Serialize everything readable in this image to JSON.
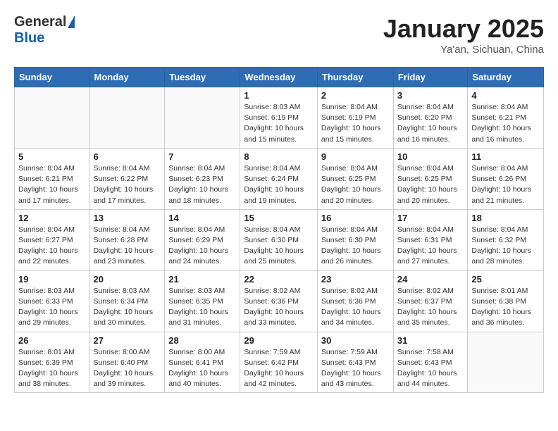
{
  "logo": {
    "general": "General",
    "blue": "Blue"
  },
  "title": "January 2025",
  "subtitle": "Ya'an, Sichuan, China",
  "weekdays": [
    "Sunday",
    "Monday",
    "Tuesday",
    "Wednesday",
    "Thursday",
    "Friday",
    "Saturday"
  ],
  "weeks": [
    [
      {
        "day": "",
        "info": ""
      },
      {
        "day": "",
        "info": ""
      },
      {
        "day": "",
        "info": ""
      },
      {
        "day": "1",
        "info": "Sunrise: 8:03 AM\nSunset: 6:19 PM\nDaylight: 10 hours\nand 15 minutes."
      },
      {
        "day": "2",
        "info": "Sunrise: 8:04 AM\nSunset: 6:19 PM\nDaylight: 10 hours\nand 15 minutes."
      },
      {
        "day": "3",
        "info": "Sunrise: 8:04 AM\nSunset: 6:20 PM\nDaylight: 10 hours\nand 16 minutes."
      },
      {
        "day": "4",
        "info": "Sunrise: 8:04 AM\nSunset: 6:21 PM\nDaylight: 10 hours\nand 16 minutes."
      }
    ],
    [
      {
        "day": "5",
        "info": "Sunrise: 8:04 AM\nSunset: 6:21 PM\nDaylight: 10 hours\nand 17 minutes."
      },
      {
        "day": "6",
        "info": "Sunrise: 8:04 AM\nSunset: 6:22 PM\nDaylight: 10 hours\nand 17 minutes."
      },
      {
        "day": "7",
        "info": "Sunrise: 8:04 AM\nSunset: 6:23 PM\nDaylight: 10 hours\nand 18 minutes."
      },
      {
        "day": "8",
        "info": "Sunrise: 8:04 AM\nSunset: 6:24 PM\nDaylight: 10 hours\nand 19 minutes."
      },
      {
        "day": "9",
        "info": "Sunrise: 8:04 AM\nSunset: 6:25 PM\nDaylight: 10 hours\nand 20 minutes."
      },
      {
        "day": "10",
        "info": "Sunrise: 8:04 AM\nSunset: 6:25 PM\nDaylight: 10 hours\nand 20 minutes."
      },
      {
        "day": "11",
        "info": "Sunrise: 8:04 AM\nSunset: 6:26 PM\nDaylight: 10 hours\nand 21 minutes."
      }
    ],
    [
      {
        "day": "12",
        "info": "Sunrise: 8:04 AM\nSunset: 6:27 PM\nDaylight: 10 hours\nand 22 minutes."
      },
      {
        "day": "13",
        "info": "Sunrise: 8:04 AM\nSunset: 6:28 PM\nDaylight: 10 hours\nand 23 minutes."
      },
      {
        "day": "14",
        "info": "Sunrise: 8:04 AM\nSunset: 6:29 PM\nDaylight: 10 hours\nand 24 minutes."
      },
      {
        "day": "15",
        "info": "Sunrise: 8:04 AM\nSunset: 6:30 PM\nDaylight: 10 hours\nand 25 minutes."
      },
      {
        "day": "16",
        "info": "Sunrise: 8:04 AM\nSunset: 6:30 PM\nDaylight: 10 hours\nand 26 minutes."
      },
      {
        "day": "17",
        "info": "Sunrise: 8:04 AM\nSunset: 6:31 PM\nDaylight: 10 hours\nand 27 minutes."
      },
      {
        "day": "18",
        "info": "Sunrise: 8:04 AM\nSunset: 6:32 PM\nDaylight: 10 hours\nand 28 minutes."
      }
    ],
    [
      {
        "day": "19",
        "info": "Sunrise: 8:03 AM\nSunset: 6:33 PM\nDaylight: 10 hours\nand 29 minutes."
      },
      {
        "day": "20",
        "info": "Sunrise: 8:03 AM\nSunset: 6:34 PM\nDaylight: 10 hours\nand 30 minutes."
      },
      {
        "day": "21",
        "info": "Sunrise: 8:03 AM\nSunset: 6:35 PM\nDaylight: 10 hours\nand 31 minutes."
      },
      {
        "day": "22",
        "info": "Sunrise: 8:02 AM\nSunset: 6:36 PM\nDaylight: 10 hours\nand 33 minutes."
      },
      {
        "day": "23",
        "info": "Sunrise: 8:02 AM\nSunset: 6:36 PM\nDaylight: 10 hours\nand 34 minutes."
      },
      {
        "day": "24",
        "info": "Sunrise: 8:02 AM\nSunset: 6:37 PM\nDaylight: 10 hours\nand 35 minutes."
      },
      {
        "day": "25",
        "info": "Sunrise: 8:01 AM\nSunset: 6:38 PM\nDaylight: 10 hours\nand 36 minutes."
      }
    ],
    [
      {
        "day": "26",
        "info": "Sunrise: 8:01 AM\nSunset: 6:39 PM\nDaylight: 10 hours\nand 38 minutes."
      },
      {
        "day": "27",
        "info": "Sunrise: 8:00 AM\nSunset: 6:40 PM\nDaylight: 10 hours\nand 39 minutes."
      },
      {
        "day": "28",
        "info": "Sunrise: 8:00 AM\nSunset: 6:41 PM\nDaylight: 10 hours\nand 40 minutes."
      },
      {
        "day": "29",
        "info": "Sunrise: 7:59 AM\nSunset: 6:42 PM\nDaylight: 10 hours\nand 42 minutes."
      },
      {
        "day": "30",
        "info": "Sunrise: 7:59 AM\nSunset: 6:43 PM\nDaylight: 10 hours\nand 43 minutes."
      },
      {
        "day": "31",
        "info": "Sunrise: 7:58 AM\nSunset: 6:43 PM\nDaylight: 10 hours\nand 44 minutes."
      },
      {
        "day": "",
        "info": ""
      }
    ]
  ]
}
